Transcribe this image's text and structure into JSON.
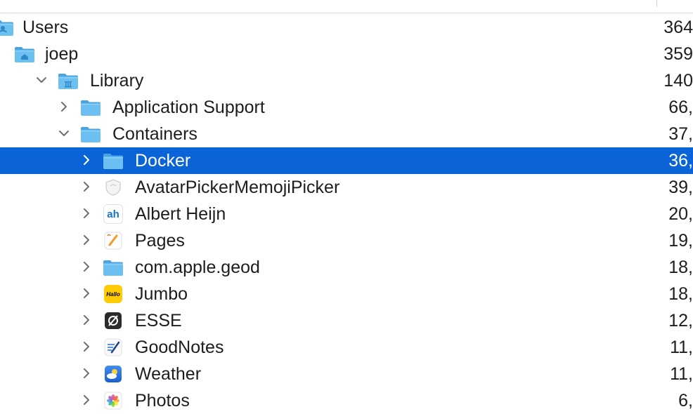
{
  "rows": [
    {
      "name": "Users",
      "size": "364",
      "expanded": true,
      "icon": "folder-users-icon",
      "level": 0,
      "selected": false
    },
    {
      "name": "joep",
      "size": "359",
      "expanded": true,
      "icon": "folder-home-icon",
      "level": 1,
      "selected": false
    },
    {
      "name": "Library",
      "size": "140",
      "expanded": true,
      "icon": "folder-library-icon",
      "level": 2,
      "selected": false
    },
    {
      "name": "Application Support",
      "size": "66,",
      "expanded": false,
      "icon": "folder-icon",
      "level": 3,
      "selected": false
    },
    {
      "name": "Containers",
      "size": "37,",
      "expanded": true,
      "icon": "folder-icon",
      "level": 3,
      "selected": false
    },
    {
      "name": "Docker",
      "size": "36,",
      "expanded": false,
      "icon": "folder-icon",
      "level": 4,
      "selected": true
    },
    {
      "name": "AvatarPickerMemojiPicker",
      "size": "39,",
      "expanded": false,
      "icon": "shield-icon",
      "level": 4,
      "selected": false
    },
    {
      "name": "Albert Heijn",
      "size": "20,",
      "expanded": false,
      "icon": "albert-heijn-icon",
      "level": 4,
      "selected": false
    },
    {
      "name": "Pages",
      "size": "19,",
      "expanded": false,
      "icon": "pages-icon",
      "level": 4,
      "selected": false
    },
    {
      "name": "com.apple.geod",
      "size": "18,",
      "expanded": false,
      "icon": "folder-icon",
      "level": 4,
      "selected": false
    },
    {
      "name": "Jumbo",
      "size": "18,",
      "expanded": false,
      "icon": "jumbo-icon",
      "level": 4,
      "selected": false
    },
    {
      "name": "ESSE",
      "size": "12,",
      "expanded": false,
      "icon": "esse-icon",
      "level": 4,
      "selected": false
    },
    {
      "name": "GoodNotes",
      "size": "11,",
      "expanded": false,
      "icon": "goodnotes-icon",
      "level": 4,
      "selected": false
    },
    {
      "name": "Weather",
      "size": "11,",
      "expanded": false,
      "icon": "weather-icon",
      "level": 4,
      "selected": false
    },
    {
      "name": "Photos",
      "size": "6,",
      "expanded": false,
      "icon": "photos-icon",
      "level": 4,
      "selected": false
    }
  ],
  "icon_text": {
    "jumbo": "Hallo"
  },
  "colors": {
    "selection": "#0a64d8",
    "folder": "#5fb4ea",
    "folder_dark": "#3a9ad9"
  }
}
